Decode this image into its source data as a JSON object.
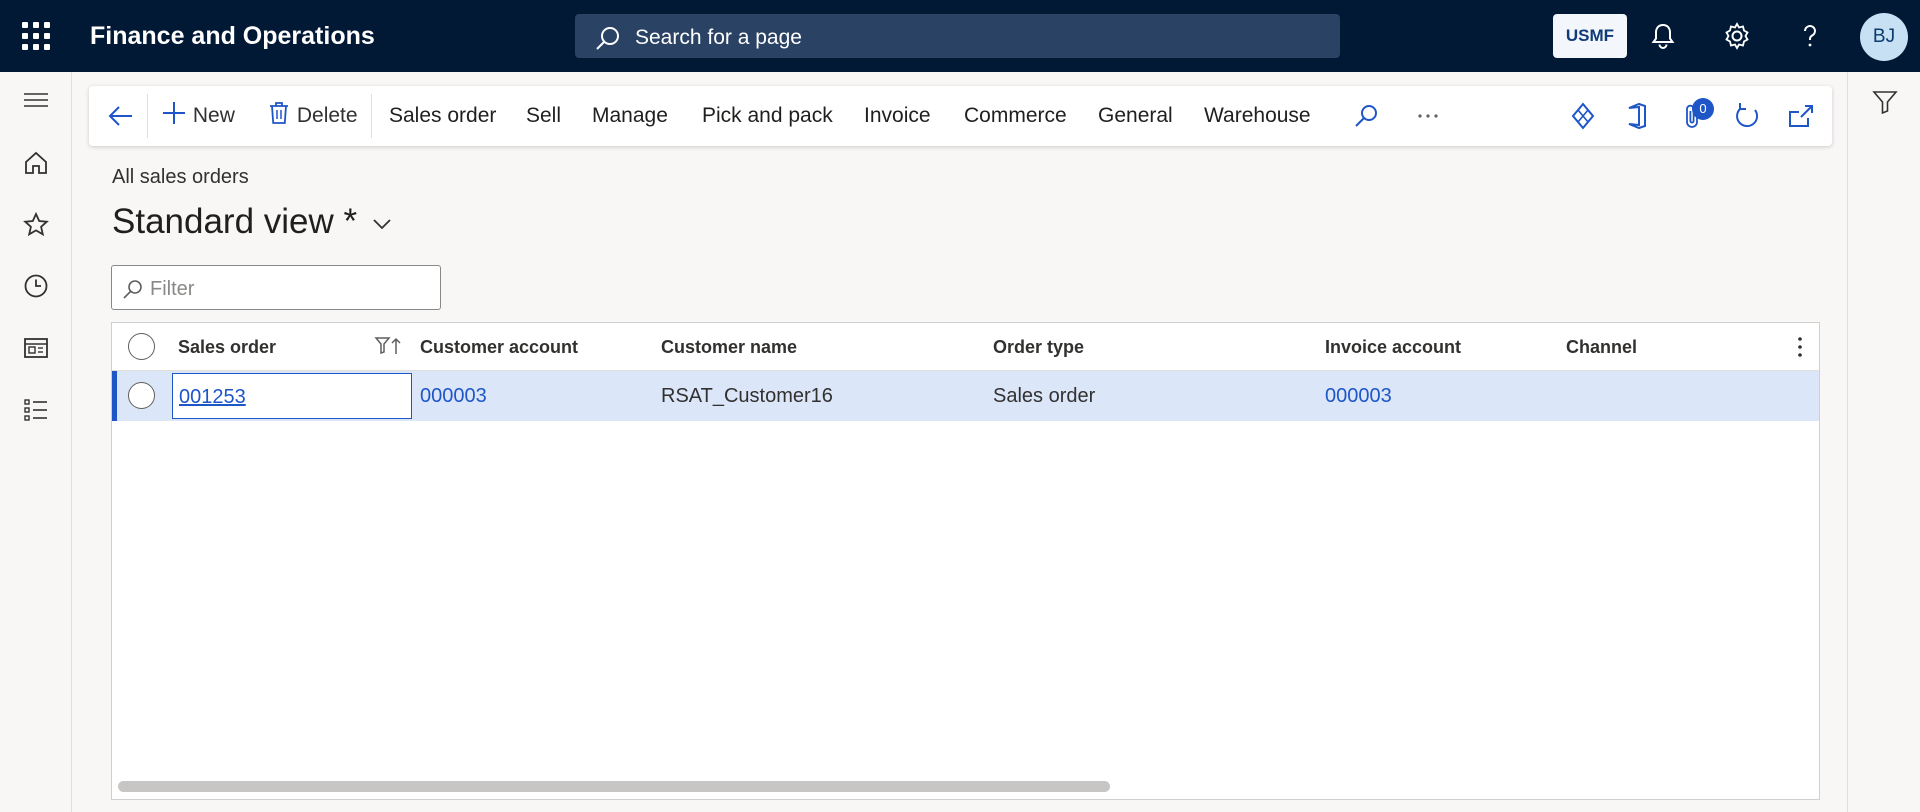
{
  "app": {
    "title": "Finance and Operations",
    "search_placeholder": "Search for a page",
    "company": "USMF",
    "user_initials": "BJ"
  },
  "actions": {
    "new": "New",
    "delete": "Delete",
    "tabs": [
      "Sales order",
      "Sell",
      "Manage",
      "Pick and pack",
      "Invoice",
      "Commerce",
      "General",
      "Warehouse"
    ],
    "attachments_count": "0"
  },
  "page": {
    "breadcrumb": "All sales orders",
    "view_title": "Standard view *",
    "filter_placeholder": "Filter"
  },
  "grid": {
    "columns": [
      "Sales order",
      "Customer account",
      "Customer name",
      "Order type",
      "Invoice account",
      "Channel"
    ],
    "rows": [
      {
        "sales_order": "001253",
        "customer_account": "000003",
        "customer_name": "RSAT_Customer16",
        "order_type": "Sales order",
        "invoice_account": "000003",
        "channel": ""
      }
    ]
  },
  "colors": {
    "topbar": "#021935",
    "accent": "#1e56c8",
    "selected_row": "#dce6f9"
  }
}
